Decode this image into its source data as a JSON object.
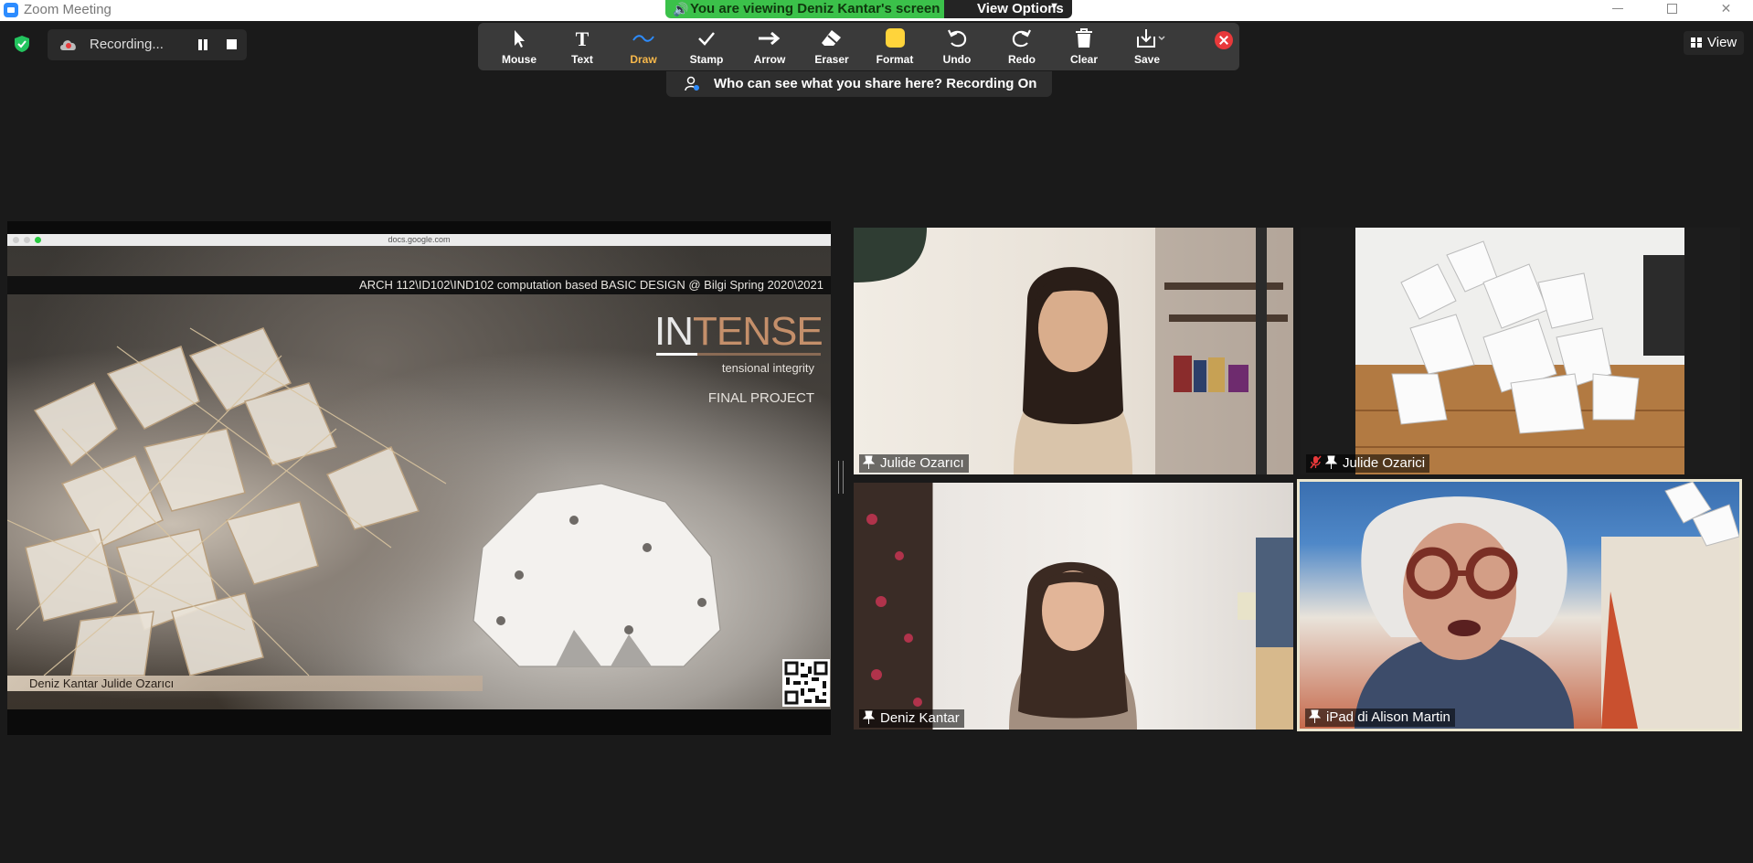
{
  "window": {
    "title": "Zoom Meeting",
    "share_banner": "You are viewing Deniz Kantar's screen",
    "view_options": "View Options"
  },
  "recording": {
    "label": "Recording..."
  },
  "annotation_toolbar": {
    "tools": [
      {
        "id": "mouse",
        "label": "Mouse",
        "icon": "cursor-icon"
      },
      {
        "id": "text",
        "label": "Text",
        "icon": "text-icon"
      },
      {
        "id": "draw",
        "label": "Draw",
        "icon": "squiggle-icon",
        "active": true
      },
      {
        "id": "stamp",
        "label": "Stamp",
        "icon": "check-icon"
      },
      {
        "id": "arrow",
        "label": "Arrow",
        "icon": "arrow-icon"
      },
      {
        "id": "eraser",
        "label": "Eraser",
        "icon": "eraser-icon"
      },
      {
        "id": "format",
        "label": "Format",
        "icon": "format-swatch-icon"
      },
      {
        "id": "undo",
        "label": "Undo",
        "icon": "undo-icon"
      },
      {
        "id": "redo",
        "label": "Redo",
        "icon": "redo-icon"
      },
      {
        "id": "clear",
        "label": "Clear",
        "icon": "trash-icon"
      },
      {
        "id": "save",
        "label": "Save",
        "icon": "save-icon"
      }
    ],
    "format_color": "#ffd43b"
  },
  "who_can_see": "Who can see what you share here? Recording On",
  "view_button": "View",
  "shared_screen": {
    "url": "docs.google.com",
    "course_line": "ARCH 112\\ID102\\IND102 computation based BASIC DESIGN @ Bilgi Spring 2020\\2021",
    "title_part1": "IN",
    "title_part2": "TENSE",
    "tagline": "tensional integrity",
    "final_project": "FINAL PROJECT",
    "authors": "Deniz Kantar Julide Ozarıcı"
  },
  "participants": [
    {
      "name": "Julide Ozarıcı",
      "muted": false
    },
    {
      "name": "Julide Ozarici",
      "muted": true
    },
    {
      "name": "Deniz Kantar",
      "muted": false
    },
    {
      "name": "iPad di Alison Martin",
      "muted": false,
      "active_speaker": true
    }
  ],
  "colors": {
    "share_green": "#3bc14a",
    "active_speaker_border": "#ebe6cf",
    "draw_active": "#f7b84b",
    "close_red": "#e8393a",
    "shield_green": "#23c45e"
  }
}
